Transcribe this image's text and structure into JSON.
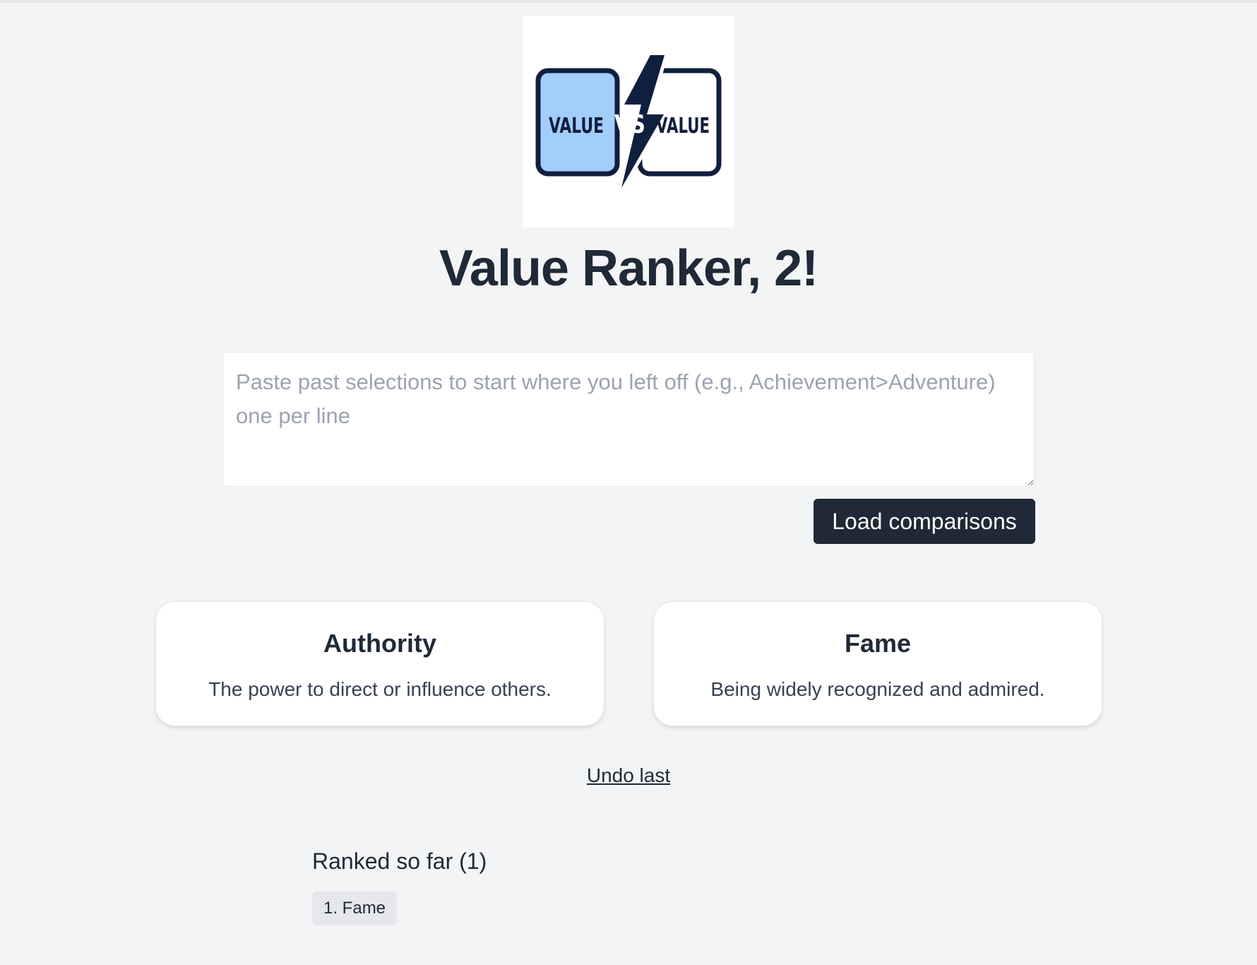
{
  "logo": {
    "left_text": "VALUE",
    "middle_text": "VS",
    "right_text": "VALUE",
    "colors": {
      "navy": "#0f1f3d",
      "light_blue": "#a3cdfa"
    }
  },
  "header": {
    "title": "Value Ranker, 2!"
  },
  "paste": {
    "value": "",
    "placeholder": "Paste past selections to start where you left off (e.g., Achievement>Adventure) one per line",
    "load_label": "Load comparisons"
  },
  "comparison": {
    "left": {
      "title": "Authority",
      "description": "The power to direct or influence others."
    },
    "right": {
      "title": "Fame",
      "description": "Being widely recognized and admired."
    }
  },
  "undo_label": "Undo last",
  "ranked": {
    "heading": "Ranked so far (1)",
    "items": [
      "1. Fame"
    ]
  },
  "colors": {
    "background": "#f3f4f6",
    "primary_button": "#1f2937",
    "text": "#1f2937",
    "badge": "#e5e7eb"
  }
}
